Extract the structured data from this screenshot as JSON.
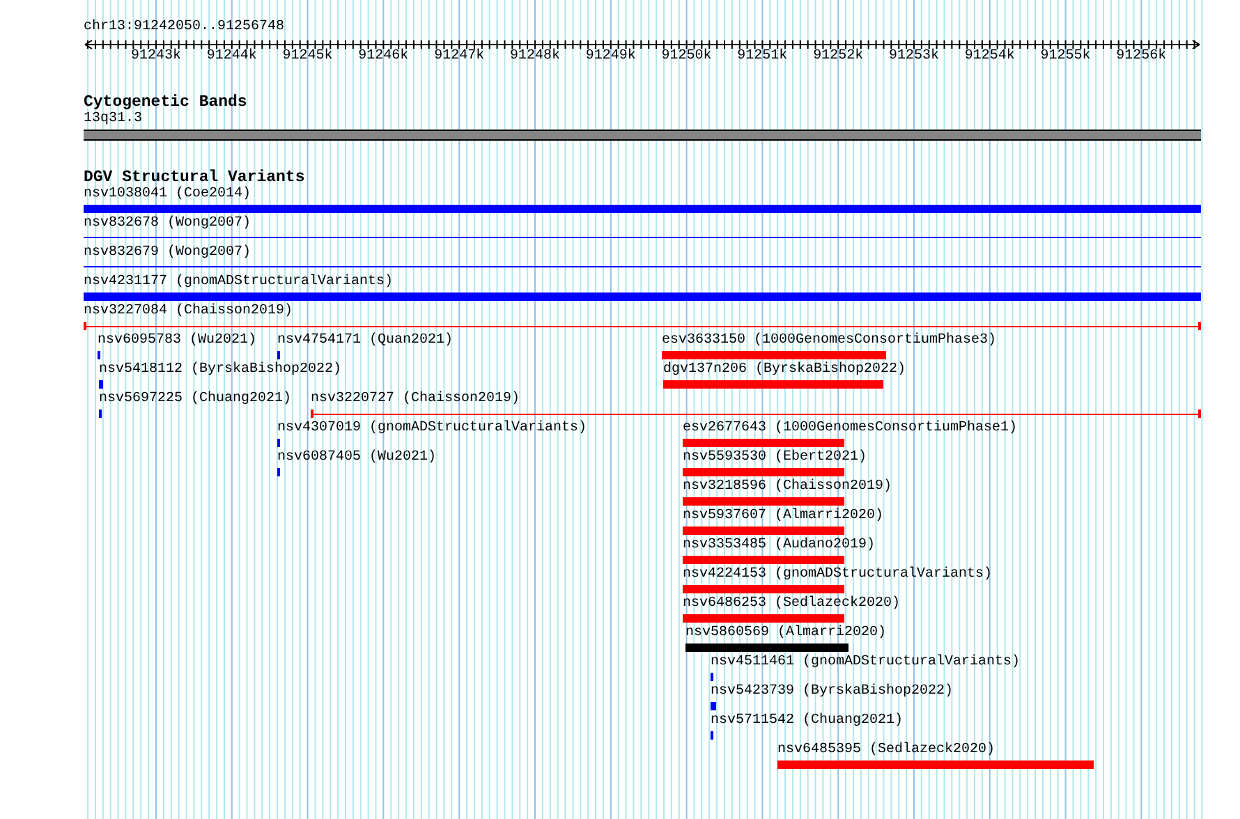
{
  "location": "chr13:91242050..91256748",
  "ruler": {
    "labels": [
      "91243k",
      "91244k",
      "91245k",
      "91246k",
      "91247k",
      "91248k",
      "91249k",
      "91250k",
      "91251k",
      "91252k",
      "91253k",
      "91254k",
      "91255k",
      "91256k"
    ]
  },
  "cytoband_track": {
    "title": "Cytogenetic Bands",
    "band": "13q31.3"
  },
  "dgv_track": {
    "title": "DGV Structural Variants",
    "features": [
      {
        "label": "nsv1038041 (Coe2014)",
        "kind": "bar",
        "color": "#0000ff"
      },
      {
        "label": "nsv832678 (Wong2007)",
        "kind": "line",
        "color": "#0000ff"
      },
      {
        "label": "nsv832679 (Wong2007)",
        "kind": "line",
        "color": "#0000ff"
      },
      {
        "label": "nsv4231177 (gnomADStructuralVariants)",
        "kind": "bar",
        "color": "#0000ff"
      },
      {
        "label": "nsv3227084 (Chaisson2019)",
        "kind": "capped",
        "color": "#ff0000"
      },
      {
        "label": "nsv6095783 (Wu2021)",
        "kind": "bar",
        "color": "#0000ff"
      },
      {
        "label": "nsv4754171 (Quan2021)",
        "kind": "bar",
        "color": "#0000ff"
      },
      {
        "label": "esv3633150 (1000GenomesConsortiumPhase3)",
        "kind": "bar",
        "color": "#ff0000"
      },
      {
        "label": "nsv5418112 (ByrskaBishop2022)",
        "kind": "bar",
        "color": "#0000ff"
      },
      {
        "label": "dgv137n206 (ByrskaBishop2022)",
        "kind": "bar",
        "color": "#ff0000"
      },
      {
        "label": "nsv5697225 (Chuang2021)",
        "kind": "bar",
        "color": "#0000ff"
      },
      {
        "label": "nsv3220727 (Chaisson2019)",
        "kind": "capped",
        "color": "#ff0000"
      },
      {
        "label": "nsv4307019 (gnomADStructuralVariants)",
        "kind": "bar",
        "color": "#0000ff"
      },
      {
        "label": "esv2677643 (1000GenomesConsortiumPhase1)",
        "kind": "bar",
        "color": "#ff0000"
      },
      {
        "label": "nsv6087405 (Wu2021)",
        "kind": "bar",
        "color": "#0000ff"
      },
      {
        "label": "nsv5593530 (Ebert2021)",
        "kind": "bar",
        "color": "#ff0000"
      },
      {
        "label": "nsv3218596 (Chaisson2019)",
        "kind": "bar",
        "color": "#ff0000"
      },
      {
        "label": "nsv5937607 (Almarri2020)",
        "kind": "bar",
        "color": "#ff0000"
      },
      {
        "label": "nsv3353485 (Audano2019)",
        "kind": "bar",
        "color": "#ff0000"
      },
      {
        "label": "nsv4224153 (gnomADStructuralVariants)",
        "kind": "bar",
        "color": "#ff0000"
      },
      {
        "label": "nsv6486253 (Sedlazeck2020)",
        "kind": "bar",
        "color": "#ff0000"
      },
      {
        "label": "nsv5860569 (Almarri2020)",
        "kind": "bar",
        "color": "#000000"
      },
      {
        "label": "nsv4511461 (gnomADStructuralVariants)",
        "kind": "bar",
        "color": "#0000ff"
      },
      {
        "label": "nsv5423739 (ByrskaBishop2022)",
        "kind": "bar",
        "color": "#0000ff"
      },
      {
        "label": "nsv5711542 (Chuang2021)",
        "kind": "bar",
        "color": "#0000ff"
      },
      {
        "label": "nsv6485395 (Sedlazeck2020)",
        "kind": "bar",
        "color": "#ff0000"
      }
    ]
  }
}
